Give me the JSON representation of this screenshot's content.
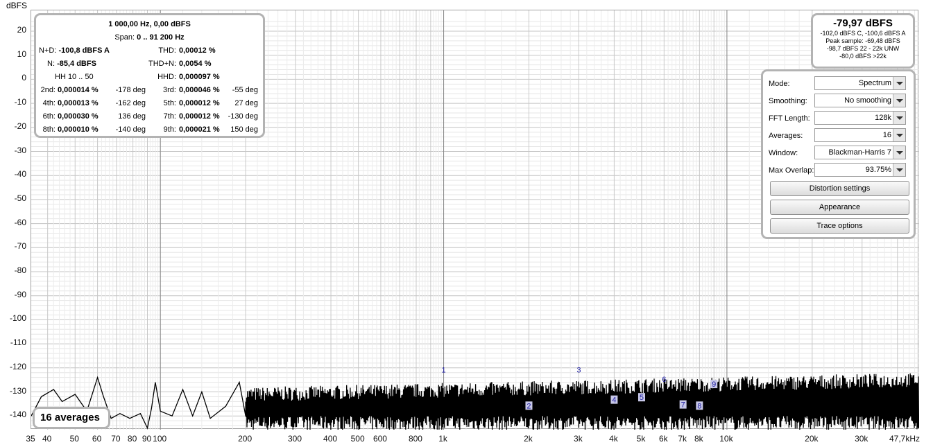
{
  "axis": {
    "unit_label": "dBFS",
    "y_ticks": [
      "20",
      "10",
      "0",
      "-10",
      "-20",
      "-30",
      "-40",
      "-50",
      "-60",
      "-70",
      "-80",
      "-90",
      "-100",
      "-110",
      "-120",
      "-130",
      "-140"
    ],
    "x_ticks": [
      "35",
      "40",
      "50",
      "60",
      "70",
      "80",
      "90",
      "100",
      "200",
      "300",
      "400",
      "500",
      "600",
      "800",
      "1k",
      "2k",
      "3k",
      "4k",
      "5k",
      "6k",
      "7k",
      "8k",
      "10k",
      "20k",
      "30k",
      "47,7kHz"
    ]
  },
  "measurements": {
    "header": "1 000,00 Hz, 0,00 dBFS",
    "span_label": "Span:",
    "span_value": "0 .. 91 200 Hz",
    "nd_label": "N+D:",
    "nd_value": "-100,8 dBFS A",
    "thd_label": "THD:",
    "thd_value": "0,00012 %",
    "n_label": "N:",
    "n_value": "-85,4 dBFS",
    "thdn_label": "THD+N:",
    "thdn_value": "0,0054 %",
    "hh_label": "HH 10 .. 50",
    "hhd_label": "HHD:",
    "hhd_value": "0,000097 %",
    "harmonics": [
      {
        "label": "2nd:",
        "value": "0,000014 %",
        "phase": "-178 deg",
        "label2": "3rd:",
        "value2": "0,000046 %",
        "phase2": "-55 deg"
      },
      {
        "label": "4th:",
        "value": "0,000013 %",
        "phase": "-162 deg",
        "label2": "5th:",
        "value2": "0,000012 %",
        "phase2": "27 deg"
      },
      {
        "label": "6th:",
        "value": "0,000030 %",
        "phase": "136 deg",
        "label2": "7th:",
        "value2": "0,000012 %",
        "phase2": "-130 deg"
      },
      {
        "label": "8th:",
        "value": "0,000010 %",
        "phase": "-140 deg",
        "label2": "9th:",
        "value2": "0,000021 %",
        "phase2": "150 deg"
      }
    ]
  },
  "level": {
    "main": "-79,97 dBFS",
    "line1": "-102,0 dBFS C, -100,6 dBFS A",
    "line2": "Peak sample: -69,48 dBFS",
    "line3": "-98,7 dBFS 22 - 22k UNW",
    "line4": "-80,0 dBFS >22k"
  },
  "controls": {
    "mode_label": "Mode:",
    "mode_value": "Spectrum",
    "smoothing_label": "Smoothing:",
    "smoothing_value": "No  smoothing",
    "fft_label": "FFT Length:",
    "fft_value": "128k",
    "averages_label": "Averages:",
    "averages_value": "16",
    "window_label": "Window:",
    "window_value": "Blackman-Harris 7",
    "overlap_label": "Max Overlap:",
    "overlap_value": "93.75%",
    "distortion_button": "Distortion settings",
    "appearance_button": "Appearance",
    "trace_button": "Trace options"
  },
  "averages_badge": "16 averages",
  "harmonic_markers": [
    "1",
    "2",
    "3",
    "4",
    "5",
    "6",
    "7",
    "8",
    "9"
  ],
  "colors": {
    "trace": "#000000",
    "grid": "#d0d0d0",
    "marker_text": "#1a1aa0",
    "marker_box": "#c8c8e8"
  }
}
